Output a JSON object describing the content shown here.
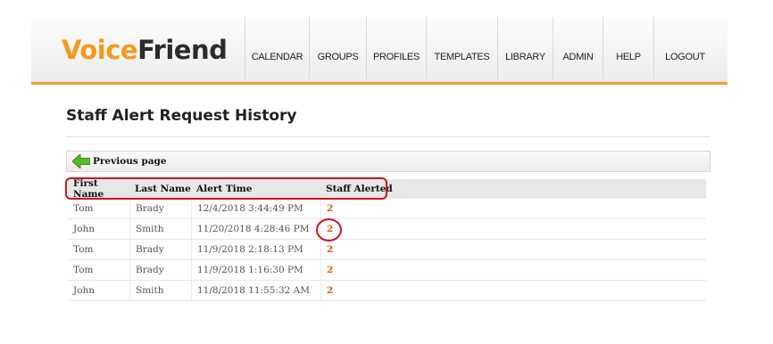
{
  "header": {
    "logo": {
      "part1": "Voice",
      "part2": "Friend"
    },
    "nav": [
      "CALENDAR",
      "GROUPS",
      "PROFILES",
      "TEMPLATES",
      "LIBRARY",
      "ADMIN",
      "HELP",
      "LOGOUT"
    ]
  },
  "page": {
    "title": "Staff Alert Request History"
  },
  "prev": {
    "label": "Previous page",
    "icon": "green-left-arrow-icon"
  },
  "table": {
    "columns": [
      "First Name",
      "Last Name",
      "Alert Time",
      "Staff Alerted"
    ],
    "rows": [
      [
        "Tom",
        "Brady",
        "12/4/2018 3:44:49 PM",
        "2"
      ],
      [
        "John",
        "Smith",
        "11/20/2018 4:28:46 PM",
        "2"
      ],
      [
        "Tom",
        "Brady",
        "11/9/2018 2:18:13 PM",
        "2"
      ],
      [
        "Tom",
        "Brady",
        "11/9/2018 1:16:30 PM",
        "2"
      ],
      [
        "John",
        "Smith",
        "11/8/2018 11:55:32 AM",
        "2"
      ]
    ]
  },
  "colors": {
    "accent": "#f39a1e",
    "link": "#e0600a",
    "highlight": "#d0141e"
  }
}
